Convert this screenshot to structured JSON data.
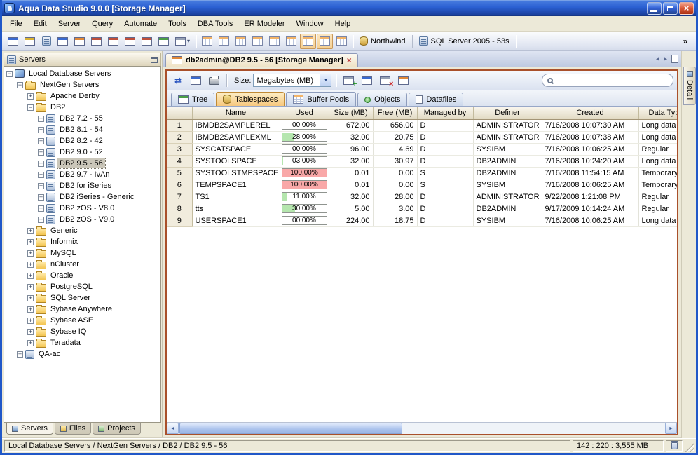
{
  "window": {
    "title": "Aqua Data Studio 9.0.0 [Storage Manager]",
    "controls": [
      "minimize",
      "maximize",
      "close"
    ]
  },
  "menubar": {
    "items": [
      "File",
      "Edit",
      "Server",
      "Query",
      "Automate",
      "Tools",
      "DBA Tools",
      "ER Modeler",
      "Window",
      "Help"
    ]
  },
  "main_toolbar": {
    "left_icons": [
      "new-window",
      "open-file",
      "registered-servers",
      "server-monitor",
      "schema-browser",
      "query-analyzer",
      "query-builder",
      "table-data-editor",
      "er-diagram",
      "import-export"
    ],
    "options_icon": "save-options",
    "grid_icons": [
      {
        "name": "grid-view-1",
        "pressed": false
      },
      {
        "name": "grid-view-2",
        "pressed": false
      },
      {
        "name": "grid-view-3",
        "pressed": false
      },
      {
        "name": "grid-view-4",
        "pressed": false
      },
      {
        "name": "grid-view-5",
        "pressed": false
      },
      {
        "name": "grid-view-6",
        "pressed": false
      },
      {
        "name": "grid-view-7",
        "pressed": true
      },
      {
        "name": "grid-view-8",
        "pressed": true
      },
      {
        "name": "grid-view-9",
        "pressed": false
      }
    ],
    "connection_label": "Northwind",
    "server_label": "SQL Server 2005 - 53s",
    "overflow_icon": "chevron-double"
  },
  "sidebar": {
    "header": "Servers",
    "tree": [
      {
        "label": "Local Database Servers",
        "depth": 0,
        "icon": "computer",
        "expander": "minus",
        "selected": false
      },
      {
        "label": "NextGen Servers",
        "depth": 1,
        "icon": "folder",
        "expander": "minus",
        "selected": false
      },
      {
        "label": "Apache Derby",
        "depth": 2,
        "icon": "folder",
        "expander": "plus",
        "selected": false
      },
      {
        "label": "DB2",
        "depth": 2,
        "icon": "folder-open",
        "expander": "minus",
        "selected": false
      },
      {
        "label": "DB2 7.2 - 55",
        "depth": 3,
        "icon": "server",
        "expander": "plus",
        "selected": false
      },
      {
        "label": "DB2 8.1 - 54",
        "depth": 3,
        "icon": "server",
        "expander": "plus",
        "selected": false
      },
      {
        "label": "DB2 8.2 - 42",
        "depth": 3,
        "icon": "server",
        "expander": "plus",
        "selected": false
      },
      {
        "label": "DB2 9.0 - 52",
        "depth": 3,
        "icon": "server",
        "expander": "plus",
        "selected": false
      },
      {
        "label": "DB2 9.5 - 56",
        "depth": 3,
        "icon": "server",
        "expander": "plus",
        "selected": true
      },
      {
        "label": "DB2 9.7 - IvAn",
        "depth": 3,
        "icon": "server",
        "expander": "plus",
        "selected": false
      },
      {
        "label": "DB2 for iSeries",
        "depth": 3,
        "icon": "server",
        "expander": "plus",
        "selected": false
      },
      {
        "label": "DB2 iSeries - Generic",
        "depth": 3,
        "icon": "server",
        "expander": "plus",
        "selected": false
      },
      {
        "label": "DB2 zOS - V8.0",
        "depth": 3,
        "icon": "server",
        "expander": "plus",
        "selected": false
      },
      {
        "label": "DB2 zOS - V9.0",
        "depth": 3,
        "icon": "server",
        "expander": "plus",
        "selected": false
      },
      {
        "label": "Generic",
        "depth": 2,
        "icon": "folder",
        "expander": "plus",
        "selected": false
      },
      {
        "label": "Informix",
        "depth": 2,
        "icon": "folder",
        "expander": "plus",
        "selected": false
      },
      {
        "label": "MySQL",
        "depth": 2,
        "icon": "folder",
        "expander": "plus",
        "selected": false
      },
      {
        "label": "nCluster",
        "depth": 2,
        "icon": "folder",
        "expander": "plus",
        "selected": false
      },
      {
        "label": "Oracle",
        "depth": 2,
        "icon": "folder",
        "expander": "plus",
        "selected": false
      },
      {
        "label": "PostgreSQL",
        "depth": 2,
        "icon": "folder",
        "expander": "plus",
        "selected": false
      },
      {
        "label": "SQL Server",
        "depth": 2,
        "icon": "folder",
        "expander": "plus",
        "selected": false
      },
      {
        "label": "Sybase Anywhere",
        "depth": 2,
        "icon": "folder",
        "expander": "plus",
        "selected": false
      },
      {
        "label": "Sybase ASE",
        "depth": 2,
        "icon": "folder",
        "expander": "plus",
        "selected": false
      },
      {
        "label": "Sybase IQ",
        "depth": 2,
        "icon": "folder",
        "expander": "plus",
        "selected": false
      },
      {
        "label": "Teradata",
        "depth": 2,
        "icon": "folder",
        "expander": "plus",
        "selected": false
      },
      {
        "label": "QA-ac",
        "depth": 1,
        "icon": "server",
        "expander": "plus",
        "selected": false
      }
    ],
    "tabs": [
      {
        "label": "Servers",
        "icon": "database",
        "active": true
      },
      {
        "label": "Files",
        "icon": "folder",
        "active": false
      },
      {
        "label": "Projects",
        "icon": "briefcase",
        "active": false
      }
    ]
  },
  "document": {
    "tab_title": "db2admin@DB2 9.5 - 56 [Storage Manager]",
    "close_glyph": "×",
    "nav_icons": [
      "prev-tab",
      "next-tab",
      "tab-list"
    ]
  },
  "storage_manager": {
    "toolbar": {
      "nav_icons": [
        "refresh",
        "export",
        "print"
      ],
      "size_label": "Size:",
      "size_value": "Megabytes (MB)",
      "edit_icons": [
        "add-tablespace",
        "edit-tablespace",
        "drop-tablespace",
        "script-tablespace"
      ],
      "search_value": ""
    },
    "tabs": [
      {
        "label": "Tree",
        "active": false
      },
      {
        "label": "Tablespaces",
        "active": true
      },
      {
        "label": "Buffer Pools",
        "active": false
      },
      {
        "label": "Objects",
        "active": false
      },
      {
        "label": "Datafiles",
        "active": false
      }
    ],
    "table": {
      "columns": [
        "Name",
        "Used",
        "Size (MB)",
        "Free (MB)",
        "Managed by",
        "Definer",
        "Created",
        "Data Type"
      ],
      "rows": [
        {
          "num": 1,
          "name": "IBMDB2SAMPLEREL",
          "used": "00.00%",
          "used_pct": 0,
          "size": "672.00",
          "free": "656.00",
          "managed": "D",
          "definer": "ADMINISTRATOR",
          "created": "7/16/2008 10:07:30 AM",
          "data_type": "Long data"
        },
        {
          "num": 2,
          "name": "IBMDB2SAMPLEXML",
          "used": "28.00%",
          "used_pct": 28,
          "size": "32.00",
          "free": "20.75",
          "managed": "D",
          "definer": "ADMINISTRATOR",
          "created": "7/16/2008 10:07:38 AM",
          "data_type": "Long data"
        },
        {
          "num": 3,
          "name": "SYSCATSPACE",
          "used": "00.00%",
          "used_pct": 0,
          "size": "96.00",
          "free": "4.69",
          "managed": "D",
          "definer": "SYSIBM",
          "created": "7/16/2008 10:06:25 AM",
          "data_type": "Regular"
        },
        {
          "num": 4,
          "name": "SYSTOOLSPACE",
          "used": "03.00%",
          "used_pct": 3,
          "size": "32.00",
          "free": "30.97",
          "managed": "D",
          "definer": "DB2ADMIN",
          "created": "7/16/2008 10:24:20 AM",
          "data_type": "Long data"
        },
        {
          "num": 5,
          "name": "SYSTOOLSTMPSPACE",
          "used": "100.00%",
          "used_pct": 100,
          "size": "0.01",
          "free": "0.00",
          "managed": "S",
          "definer": "DB2ADMIN",
          "created": "7/16/2008 11:54:15 AM",
          "data_type": "Temporary"
        },
        {
          "num": 6,
          "name": "TEMPSPACE1",
          "used": "100.00%",
          "used_pct": 100,
          "size": "0.01",
          "free": "0.00",
          "managed": "S",
          "definer": "SYSIBM",
          "created": "7/16/2008 10:06:25 AM",
          "data_type": "Temporary"
        },
        {
          "num": 7,
          "name": "TS1",
          "used": "11.00%",
          "used_pct": 11,
          "size": "32.00",
          "free": "28.00",
          "managed": "D",
          "definer": "ADMINISTRATOR",
          "created": "9/22/2008 1:21:08 PM",
          "data_type": "Regular"
        },
        {
          "num": 8,
          "name": "tts",
          "used": "30.00%",
          "used_pct": 30,
          "size": "5.00",
          "free": "3.00",
          "managed": "D",
          "definer": "DB2ADMIN",
          "created": "9/17/2009 10:14:24 AM",
          "data_type": "Regular"
        },
        {
          "num": 9,
          "name": "USERSPACE1",
          "used": "00.00%",
          "used_pct": 0,
          "size": "224.00",
          "free": "18.75",
          "managed": "D",
          "definer": "SYSIBM",
          "created": "7/16/2008 10:06:25 AM",
          "data_type": "Long data"
        }
      ]
    }
  },
  "detail_panel": {
    "label": "Detail"
  },
  "statusbar": {
    "breadcrumb": "Local Database Servers / NextGen Servers / DB2 / DB2 9.5 - 56",
    "memory": "142 : 220 : 3,555 MB"
  },
  "colors": {
    "used_partial": "#b5e6ae",
    "used_full": "#f9a8a8",
    "panel_border": "#a9502b",
    "active_tab": "#f7c87e",
    "titlebar": "#2a5fd2"
  }
}
